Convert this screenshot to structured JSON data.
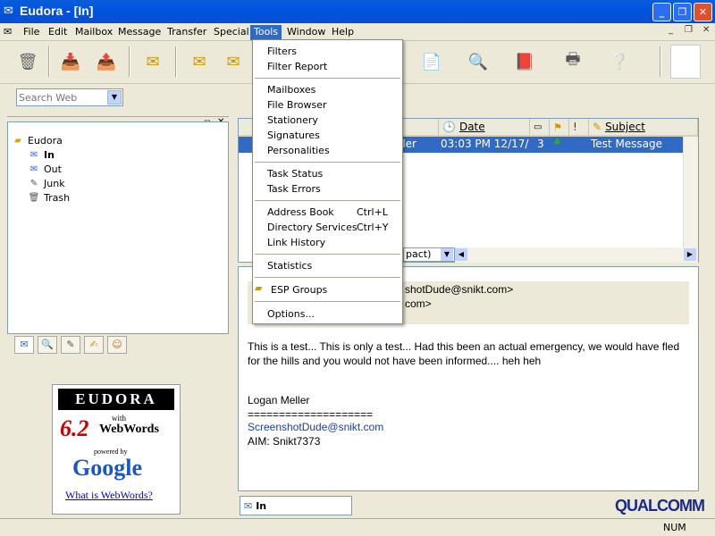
{
  "window": {
    "title": "Eudora - [In]"
  },
  "menu": {
    "items": [
      "File",
      "Edit",
      "Mailbox",
      "Message",
      "Transfer",
      "Special",
      "Tools",
      "Window",
      "Help"
    ],
    "active": "Tools"
  },
  "search": {
    "placeholder": "Search Web"
  },
  "tree": {
    "root": "Eudora",
    "items": [
      "In",
      "Out",
      "Junk",
      "Trash"
    ]
  },
  "ad": {
    "eudora": "EUDORA",
    "version": "6.2",
    "with": "with",
    "webwords": "WebWords",
    "powered_by": "powered by",
    "google": "Google",
    "link": "What is WebWords?"
  },
  "list": {
    "columns": {
      "date": "Date",
      "subject": "Subject"
    },
    "row": {
      "sender": "ller",
      "date": "03:03 PM 12/17/",
      "attachments": "3",
      "subject": "Test Message"
    },
    "view_select": "pact)"
  },
  "preview": {
    "from_line": "shotDude@snikt.com>",
    "to_line": "com>",
    "body1": "This is a test... This is only a test... Had this been an actual emergency, we would have fled",
    "body2": "for the hills and you would not have been informed.... heh heh",
    "sig_name": "Logan Meller",
    "sig_rule": "====================",
    "sig_email": "ScreenshotDude@snikt.com",
    "sig_aim": "AIM: Snikt7373"
  },
  "mailbox_tab": "In",
  "brand": "QUALCOMM",
  "status": {
    "num": "NUM"
  },
  "tools_menu": {
    "filters": "Filters",
    "filter_report": "Filter Report",
    "mailboxes": "Mailboxes",
    "file_browser": "File Browser",
    "stationery": "Stationery",
    "signatures": "Signatures",
    "personalities": "Personalities",
    "task_status": "Task Status",
    "task_errors": "Task Errors",
    "address_book": "Address Book",
    "address_book_shortcut": "Ctrl+L",
    "directory_services": "Directory Services",
    "directory_services_shortcut": "Ctrl+Y",
    "link_history": "Link History",
    "statistics": "Statistics",
    "esp_groups": "ESP Groups",
    "options": "Options..."
  }
}
